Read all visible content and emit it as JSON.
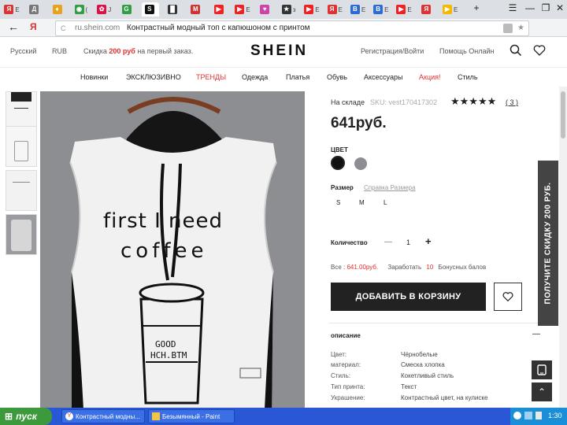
{
  "browser": {
    "tabs": [
      {
        "icon": "Я",
        "color": "#d33",
        "text": "Е"
      },
      {
        "icon": "Д",
        "color": "#777",
        "text": ""
      },
      {
        "icon": "♦",
        "color": "#e8a31e",
        "text": ""
      },
      {
        "icon": "◉",
        "color": "#2f9e44",
        "text": "("
      },
      {
        "icon": "✿",
        "color": "#d14",
        "text": "J"
      },
      {
        "icon": "G",
        "color": "#2f9e44",
        "text": ""
      },
      {
        "icon": "S",
        "color": "#111",
        "text": ""
      },
      {
        "icon": "█",
        "color": "#333",
        "text": ""
      },
      {
        "icon": "M",
        "color": "#c33",
        "text": ""
      },
      {
        "icon": "▶",
        "color": "#e22",
        "text": ""
      },
      {
        "icon": "▶",
        "color": "#e22",
        "text": "E"
      },
      {
        "icon": "♥",
        "color": "#c4a",
        "text": ""
      },
      {
        "icon": "★",
        "color": "#333",
        "text": "з"
      },
      {
        "icon": "▶",
        "color": "#e22",
        "text": "E"
      },
      {
        "icon": "Я",
        "color": "#d33",
        "text": "Е"
      },
      {
        "icon": "B",
        "color": "#2b6cd4",
        "text": "E"
      },
      {
        "icon": "B",
        "color": "#2b6cd4",
        "text": "E"
      },
      {
        "icon": "▶",
        "color": "#e22",
        "text": "E"
      },
      {
        "icon": "Я",
        "color": "#d33",
        "text": ""
      },
      {
        "icon": "▶",
        "color": "#f5b800",
        "text": "E"
      }
    ],
    "new_tab_label": "+",
    "menu_label": "☰",
    "minimize_label": "—",
    "restore_label": "❐",
    "close_label": "✕",
    "back_label": "←",
    "yandex_label": "Я",
    "refresh_label": "C",
    "url": "ru.shein.com",
    "page_title": "Контрастный модный топ с капюшоном с принтом"
  },
  "site": {
    "language": "Русский",
    "currency": "RUB",
    "promo_prefix": "Скидка ",
    "promo_amount": "200 руб",
    "promo_suffix": " на первый заказ.",
    "logo": "SHEIN",
    "register_login": "Регистрация/Войти",
    "online_help": "Помощь Онлайн",
    "nav": [
      "Новинки",
      "ЭКСКЛЮЗИВНО",
      "ТРЕНДЫ",
      "Одежда",
      "Платья",
      "Обувь",
      "Аксессуары",
      "Акция!",
      "Стиль"
    ],
    "nav_highlight_color": "#e0312e"
  },
  "product": {
    "shirt_text_line1": "first I need",
    "shirt_text_line2": "coffee",
    "cup_text_line1": "GOOD",
    "cup_text_line2": "HCH.BTM",
    "stock": "На складе",
    "sku": "SKU: vest170417302",
    "rating_count": "( 3 )",
    "price": "641руб.",
    "color_label": "ЦВЕТ",
    "colors": [
      "#111111",
      "#8e8e92"
    ],
    "size_label": "Размер",
    "size_guide": "Справка Размера",
    "sizes": [
      "S",
      "M",
      "L"
    ],
    "quantity_label": "Количество",
    "quantity_minus": "—",
    "quantity_value": "1",
    "quantity_plus": "+",
    "total_label": "Все : ",
    "total_value": "641.00руб.",
    "earn_label": "Заработать",
    "earn_points": "10",
    "bonus_label": "Бонусных балов",
    "add_to_cart": "ДОБАВИТЬ В КОРЗИНУ",
    "description_title": "описание",
    "description_toggle": "—",
    "description": [
      {
        "key": "Цвет:",
        "value": "Чёрнобелые"
      },
      {
        "key": "материал:",
        "value": "Смеска хлопка"
      },
      {
        "key": "Стиль:",
        "value": "Кокетливый стиль"
      },
      {
        "key": "Тип принта:",
        "value": "Текст"
      },
      {
        "key": "Украшение:",
        "value": "Контрастный цвет, на кулиске"
      }
    ]
  },
  "sidebar": {
    "promo_vertical": "ПОЛУЧИТЕ СКИДКУ 200 РУБ.",
    "up_label": "⌃"
  },
  "taskbar": {
    "start_label": "пуск",
    "items": [
      "Контрастный модны...",
      "Безымянный - Paint"
    ],
    "clock": "1:30"
  }
}
